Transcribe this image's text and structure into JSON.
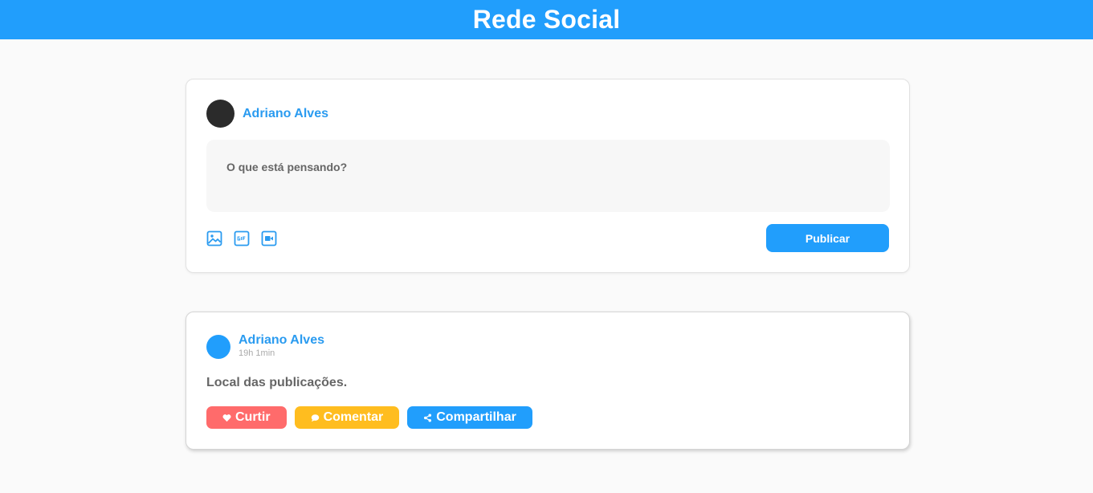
{
  "header": {
    "title": "Rede Social"
  },
  "composer": {
    "author": "Adriano Alves",
    "placeholder": "O que está pensando?",
    "icons": [
      "image-icon",
      "gif-icon",
      "video-icon"
    ],
    "publish_label": "Publicar"
  },
  "post": {
    "author": "Adriano Alves",
    "time": "19h 1min",
    "content": "Local das publicações.",
    "actions": {
      "like": "Curtir",
      "comment": "Comentar",
      "share": "Compartilhar"
    }
  },
  "colors": {
    "accent": "#219efc",
    "like": "#ff6b6b",
    "comment": "#ffbd1f",
    "background": "#fafafa"
  }
}
